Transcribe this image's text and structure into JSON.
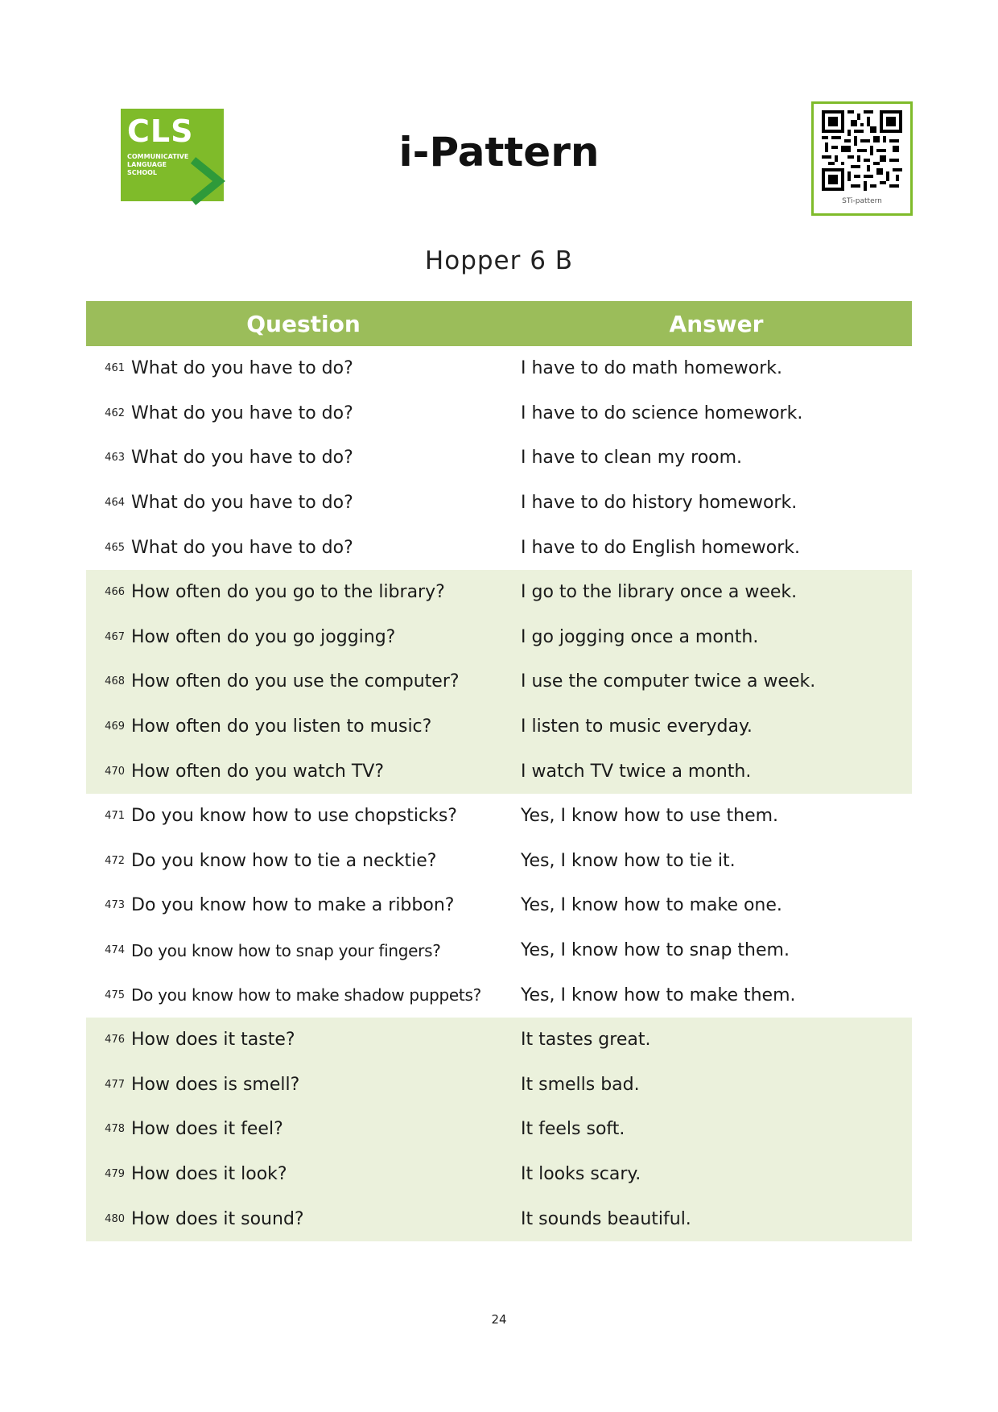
{
  "logo": {
    "text": "CLS",
    "subtitle_lines": [
      "COMMUNICATIVE",
      "LANGUAGE",
      "SCHOOL"
    ],
    "color": "#7fbb2a"
  },
  "title": "i-Pattern",
  "qr": {
    "label": "STi-pattern"
  },
  "subtitle": "Hopper 6 B",
  "table": {
    "header_color": "#9bbd5a",
    "shade_color": "#ebf1dc",
    "headers": {
      "question": "Question",
      "answer": "Answer"
    },
    "rows": [
      {
        "num": "461",
        "q": "What do you have to do?",
        "a": "I have to do math homework."
      },
      {
        "num": "462",
        "q": "What do you have to do?",
        "a": "I have to do science homework."
      },
      {
        "num": "463",
        "q": "What do you have to do?",
        "a": "I have to clean my room."
      },
      {
        "num": "464",
        "q": "What do you have to do?",
        "a": "I have to do history homework."
      },
      {
        "num": "465",
        "q": "What do you have to do?",
        "a": "I have to do English homework."
      },
      {
        "num": "466",
        "q": "How often do you go to the library?",
        "a": "I go to the library once a week."
      },
      {
        "num": "467",
        "q": "How often do you go jogging?",
        "a": "I go jogging once a month."
      },
      {
        "num": "468",
        "q": "How often do you use the computer?",
        "a": "I use the computer twice a week."
      },
      {
        "num": "469",
        "q": "How often do you listen to music?",
        "a": "I listen to music everyday."
      },
      {
        "num": "470",
        "q": "How often do you watch TV?",
        "a": "I watch TV twice a month."
      },
      {
        "num": "471",
        "q": "Do you know how to use chopsticks?",
        "a": "Yes, I know how to use them."
      },
      {
        "num": "472",
        "q": "Do you know how to tie a necktie?",
        "a": "Yes, I know how to tie it."
      },
      {
        "num": "473",
        "q": "Do you know how to make a ribbon?",
        "a": "Yes, I know how to make one."
      },
      {
        "num": "474",
        "q": "Do you know how to snap your fingers?",
        "a": "Yes, I know how to snap them."
      },
      {
        "num": "475",
        "q": "Do you know how to make shadow puppets?",
        "a": "Yes, I know how to make them."
      },
      {
        "num": "476",
        "q": "How does it taste?",
        "a": "It tastes great."
      },
      {
        "num": "477",
        "q": "How does is smell?",
        "a": "It smells bad."
      },
      {
        "num": "478",
        "q": "How does it feel?",
        "a": "It feels soft."
      },
      {
        "num": "479",
        "q": "How does it look?",
        "a": "It looks scary."
      },
      {
        "num": "480",
        "q": "How does it sound?",
        "a": "It sounds beautiful."
      }
    ]
  },
  "page_number": "24"
}
